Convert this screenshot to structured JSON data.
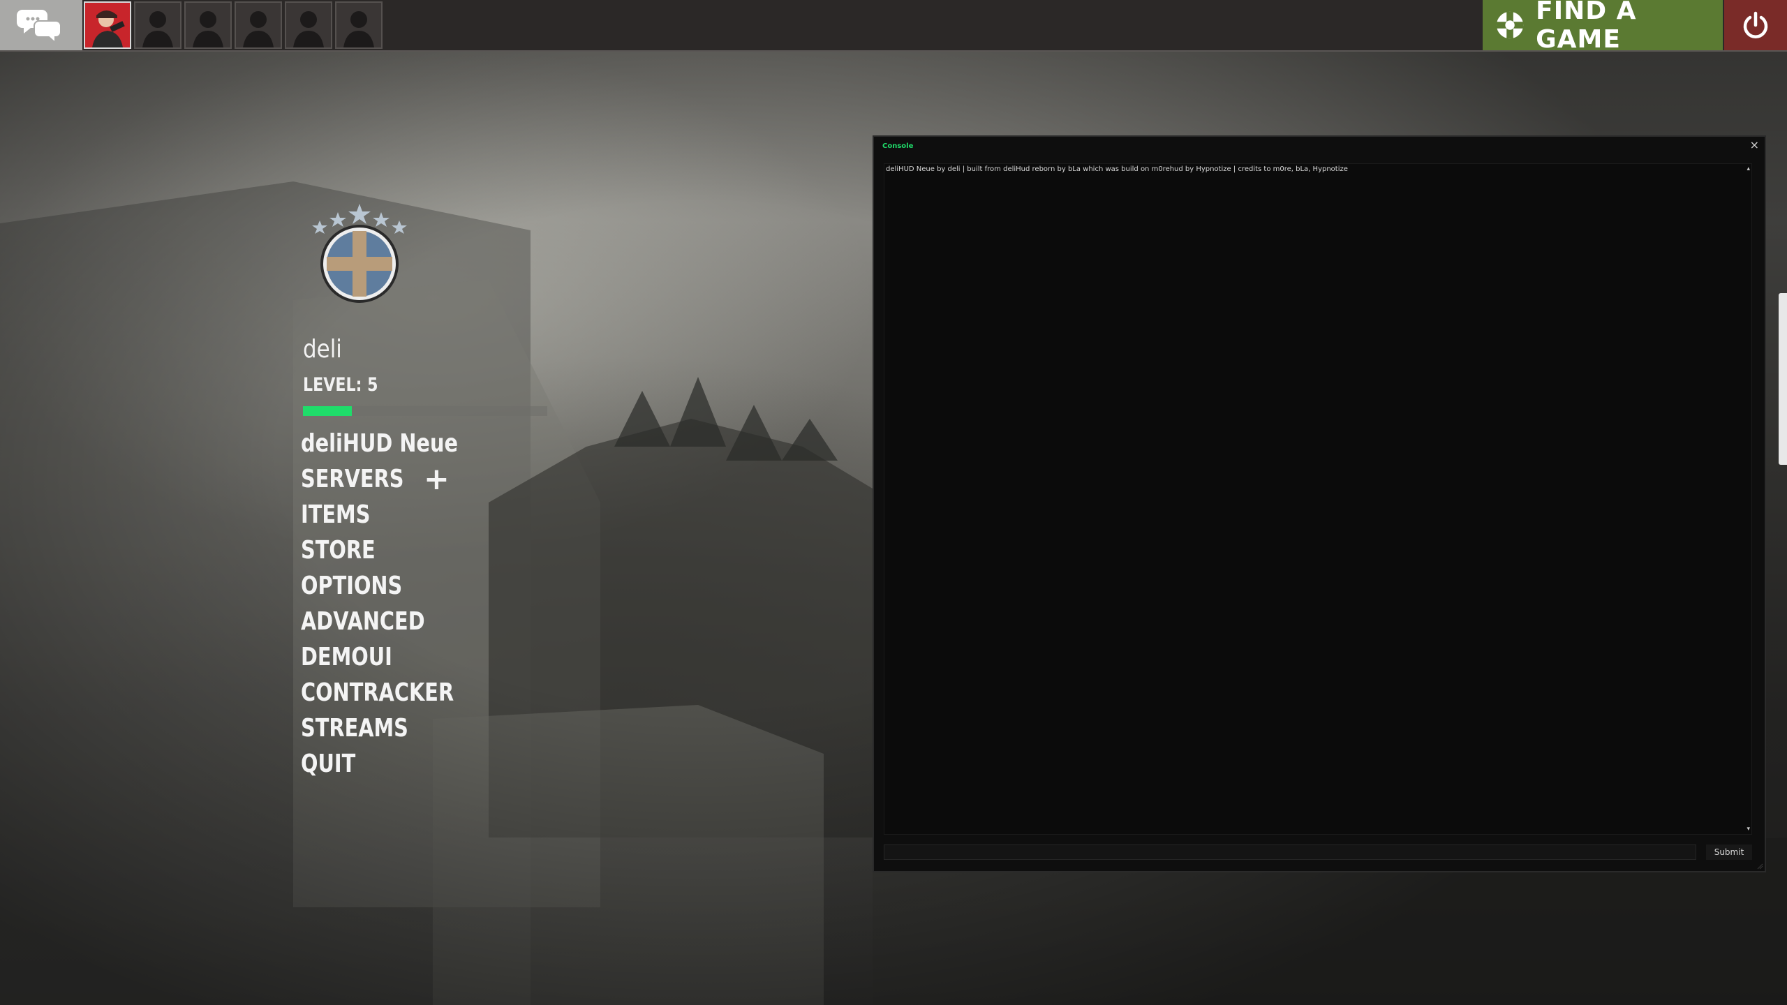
{
  "topbar": {
    "party_slots": [
      "player-avatar",
      "empty-slot",
      "empty-slot",
      "empty-slot",
      "empty-slot",
      "empty-slot"
    ],
    "find_game_label": "FIND A GAME",
    "colors": {
      "find_game": "#5b7a32",
      "quit": "#7a2b28",
      "bar": "#2b2827"
    }
  },
  "player": {
    "name": "deli",
    "level_text": "LEVEL: 5",
    "xp_progress": 0.2
  },
  "menu": {
    "items": [
      "deliHUD Neue",
      "SERVERS",
      "ITEMS",
      "STORE",
      "OPTIONS",
      "ADVANCED",
      "DEMOUI",
      "CONTRACKER",
      "STREAMS",
      "QUIT"
    ],
    "servers_add": "+"
  },
  "console": {
    "title": "Console",
    "close": "×",
    "output": "deliHUD Neue by deli | built from deliHud reborn by bLa which was build on m0rehud by Hypnotize | credits to m0re, bLa, Hypnotize",
    "input_value": "",
    "submit_label": "Submit",
    "scroll_up": "▴",
    "scroll_down": "▾",
    "colors": {
      "title": "#1fdc6a",
      "background": "#0e0e0e"
    }
  },
  "icons": {
    "chat": "chat-bubbles-icon",
    "find_game": "tf2-logo-icon",
    "power": "power-icon",
    "rank": "rank-emblem-icon"
  }
}
